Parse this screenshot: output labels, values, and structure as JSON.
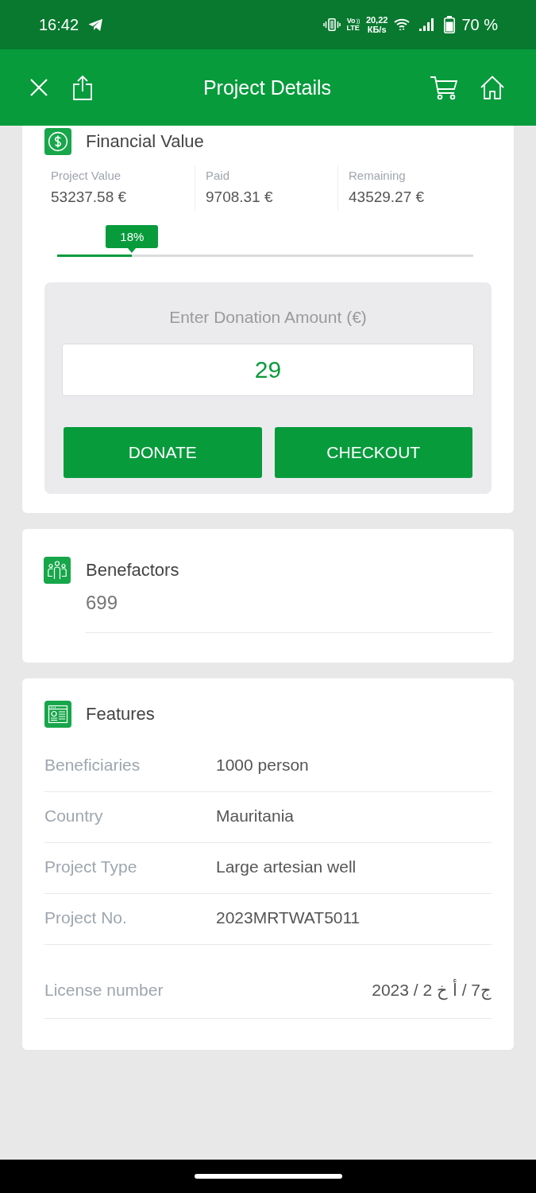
{
  "status_bar": {
    "time": "16:42",
    "volte": [
      "Vo",
      "LTE"
    ],
    "network_speed": [
      "20,22",
      "КБ/s"
    ],
    "battery": "70 %"
  },
  "header": {
    "title": "Project Details"
  },
  "financial_card": {
    "title": "Financial Value",
    "stats": [
      {
        "label": "Project Value",
        "value": "53237.58 €"
      },
      {
        "label": "Paid",
        "value": "9708.31 €"
      },
      {
        "label": "Remaining",
        "value": "43529.27 €"
      }
    ],
    "progress": {
      "label": "18%",
      "level": 0.18
    },
    "donation": {
      "title": "Enter Donation Amount (€)",
      "value": "29",
      "buttons": [
        "DONATE",
        "CHECKOUT"
      ]
    }
  },
  "benefactors_card": {
    "title": "Benefactors",
    "value": "699"
  },
  "features_card": {
    "title": "Features",
    "rows": [
      {
        "kind": "column",
        "label": "Beneficiaries",
        "value": "1000 person"
      },
      {
        "kind": "column",
        "label": "Country",
        "value": "Mauritania"
      },
      {
        "kind": "column",
        "label": "Project Type",
        "value": "Large artesian well"
      },
      {
        "kind": "column",
        "label": "Project No.",
        "value": "2023MRTWAT5011"
      },
      {
        "kind": "spread",
        "label": "License number",
        "value": "ج7 / أ خ 2 / 2023"
      }
    ]
  }
}
